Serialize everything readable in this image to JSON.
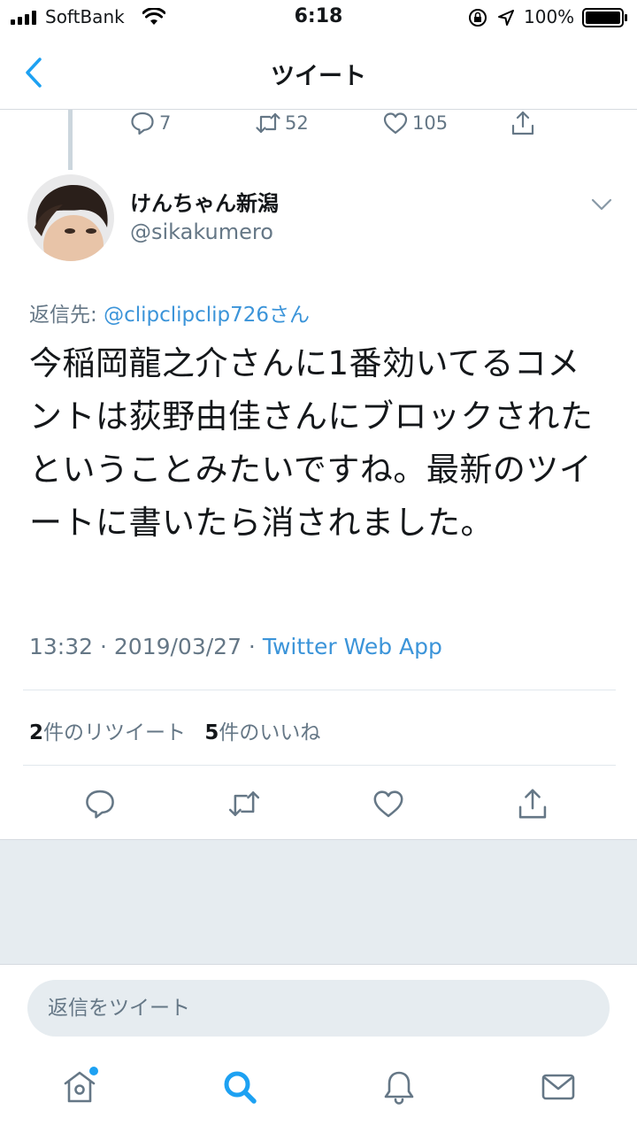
{
  "status_bar": {
    "carrier": "SoftBank",
    "time": "6:18",
    "battery": "100%"
  },
  "nav": {
    "title": "ツイート"
  },
  "previous_tweet": {
    "replies": "7",
    "retweets": "52",
    "likes": "105"
  },
  "tweet": {
    "display_name": "けんちゃん新潟",
    "handle": "@sikakumero",
    "reply_label": "返信先: ",
    "reply_mention": "@clipclipclip726さん",
    "text": "今稲岡龍之介さんに1番効いてるコメントは荻野由佳さんにブロックされたということみたいですね。最新のツイートに書いたら消されました。",
    "time": "13:32 · 2019/03/27 · ",
    "source": "Twitter Web App",
    "retweet_count": "2",
    "retweet_label": "件のリツイート",
    "like_count": "5",
    "like_label": "件のいいね"
  },
  "reply_box": {
    "placeholder": "返信をツイート"
  },
  "colors": {
    "accent": "#1da1f2",
    "link": "#3b94d9",
    "secondary_text": "#657786",
    "divider": "#e1e8ed",
    "background_gray": "#e6ecf0"
  },
  "icons": {
    "back": "chevron-left-icon",
    "reply": "speech-bubble-icon",
    "retweet": "retweet-icon",
    "like": "heart-icon",
    "share": "share-icon",
    "caret": "chevron-down-icon",
    "home": "home-icon",
    "search": "search-icon",
    "notifications": "bell-icon",
    "messages": "envelope-icon"
  }
}
